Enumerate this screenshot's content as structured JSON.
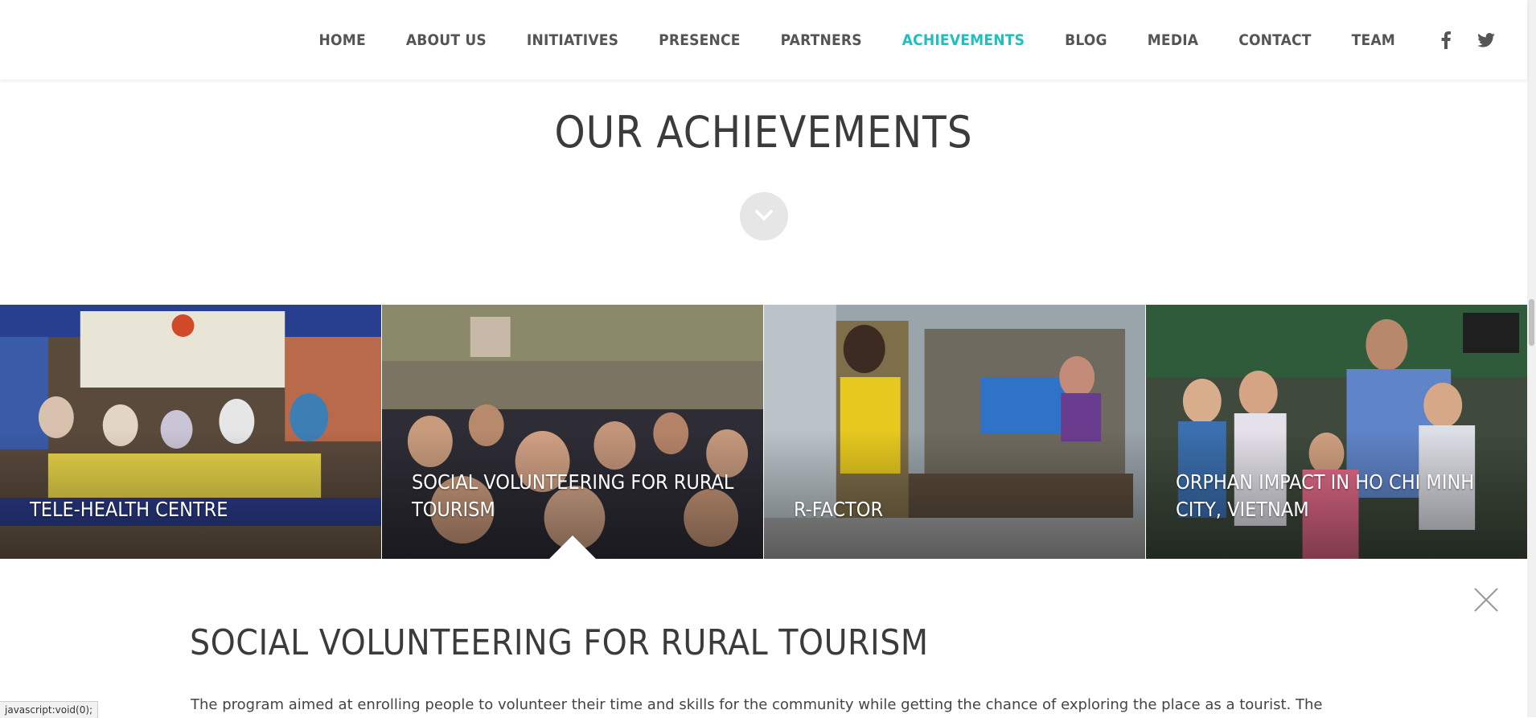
{
  "nav": {
    "items": [
      "HOME",
      "ABOUT US",
      "INITIATIVES",
      "PRESENCE",
      "PARTNERS",
      "ACHIEVEMENTS",
      "BLOG",
      "MEDIA",
      "CONTACT",
      "TEAM"
    ],
    "active": "ACHIEVEMENTS",
    "social": [
      "facebook-icon",
      "twitter-icon"
    ]
  },
  "section": {
    "title": "OUR ACHIEVEMENTS",
    "toggle_icon": "chevron-down-icon"
  },
  "gallery": [
    {
      "label": "TELE-HEALTH CENTRE"
    },
    {
      "label": "SOCIAL VOLUNTEERING FOR RURAL TOURISM"
    },
    {
      "label": "R-FACTOR"
    },
    {
      "label": "ORPHAN IMPACT IN HO CHI MINH CITY, VIETNAM"
    }
  ],
  "detail": {
    "title": "SOCIAL VOLUNTEERING FOR RURAL TOURISM",
    "body": "The program aimed at enrolling people to volunteer their time and skills for the community while getting the chance of exploring the place as a tourist. The",
    "close_icon": "close-icon"
  },
  "status_bar": "javascript:void(0);",
  "colors": {
    "accent": "#1fbfbf",
    "text": "#444444",
    "heading": "#3b3b3b"
  }
}
